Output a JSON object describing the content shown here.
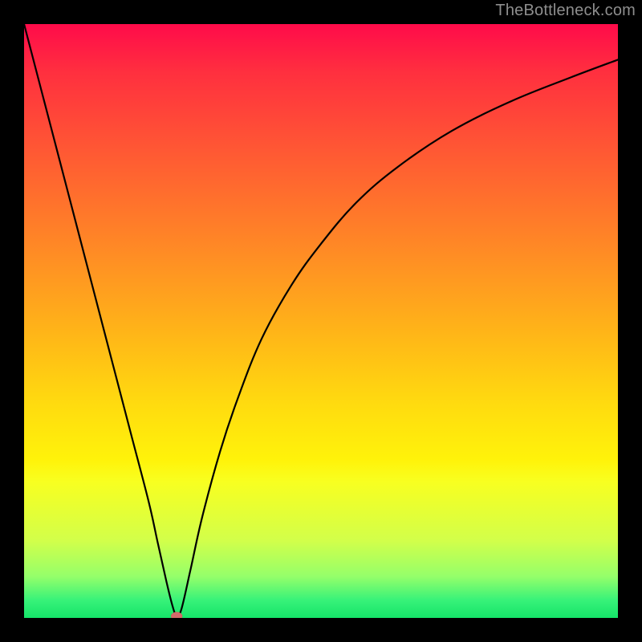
{
  "watermark": "TheBottleneck.com",
  "chart_data": {
    "type": "line",
    "title": "",
    "xlabel": "",
    "ylabel": "",
    "xlim": [
      0,
      100
    ],
    "ylim": [
      0,
      100
    ],
    "grid": false,
    "legend": false,
    "background": {
      "style": "vertical-gradient",
      "stops": [
        {
          "pos": 0,
          "color": "#ff0b4a"
        },
        {
          "pos": 22,
          "color": "#ff5a33"
        },
        {
          "pos": 52,
          "color": "#ffb518"
        },
        {
          "pos": 73,
          "color": "#fff30a"
        },
        {
          "pos": 93,
          "color": "#95ff6a"
        },
        {
          "pos": 100,
          "color": "#15e469"
        }
      ]
    },
    "series": [
      {
        "name": "bottleneck-curve",
        "x": [
          0,
          3,
          6,
          9,
          12,
          15,
          18,
          21,
          22.5,
          24,
          25,
          25.7,
          26.5,
          28,
          30,
          33,
          36,
          40,
          45,
          50,
          56,
          63,
          72,
          82,
          92,
          100
        ],
        "y": [
          100,
          88.5,
          77,
          65.5,
          54,
          42.5,
          31,
          19.5,
          12.7,
          6,
          2,
          0.3,
          1.5,
          8,
          17,
          28,
          37,
          47,
          56,
          63,
          70,
          76,
          82,
          87,
          91,
          94
        ],
        "color": "#000000"
      }
    ],
    "marker": {
      "name": "optimum-point",
      "x": 25.7,
      "y": 0.3,
      "shape": "oval",
      "color": "#d36a6b"
    }
  }
}
